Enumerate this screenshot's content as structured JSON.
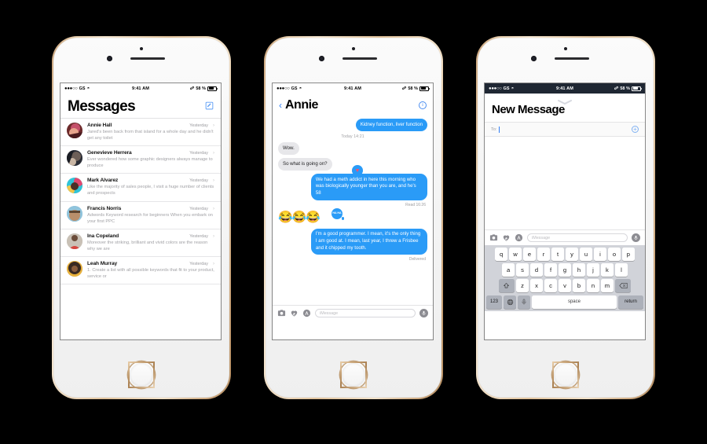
{
  "status_bar": {
    "carrier": "GS",
    "signal_dots": "●●●○○",
    "wifi_icon": "wifi-icon",
    "time": "9:41 AM",
    "bluetooth_icon": "bluetooth-icon",
    "battery_percent": "58 %"
  },
  "phone1": {
    "title": "Messages",
    "compose_icon": "compose-icon",
    "conversations": [
      {
        "name": "Annie Hall",
        "time": "Yesterday",
        "preview": "Jared's been back from that island for a whole day and he didn't get any toilet",
        "avatar_colors": [
          "#6d2a2b",
          "#c4506a",
          "#e7a48c"
        ]
      },
      {
        "name": "Genevieve Herrera",
        "time": "Yesterday",
        "preview": "Ever wondered how some graphic designers always manage to produce",
        "avatar_colors": [
          "#2a2d36",
          "#6d5f58",
          "#c9b6a4"
        ]
      },
      {
        "name": "Mark Alvarez",
        "time": "Yesterday",
        "preview": "Like the majority of sales people, I visit a huge number of clients and prospects",
        "avatar_colors": [
          "#2fc4d8",
          "#e0486f",
          "#f2c64a"
        ]
      },
      {
        "name": "Francis Norris",
        "time": "Yesterday",
        "preview": "Adwords Keyword research for beginners When you embark on your first PPC",
        "avatar_colors": [
          "#8fc4dd",
          "#b98f6b",
          "#5d4632"
        ]
      },
      {
        "name": "Ina Copeland",
        "time": "Yesterday",
        "preview": "Moreover the striking, brilliant and vivid colors are the reason why we are",
        "avatar_colors": [
          "#c9c1b6",
          "#d6453f",
          "#6b4c3a"
        ]
      },
      {
        "name": "Leah Murray",
        "time": "Yesterday",
        "preview": "1. Create a list with all possible keywords that fit to your product, service or",
        "avatar_colors": [
          "#e8b13c",
          "#3a2a22",
          "#8a5c3c"
        ]
      }
    ],
    "chevron": "›"
  },
  "phone2": {
    "back_icon": "back-chevron-icon",
    "title": "Annie",
    "info_icon": "info-icon",
    "messages": [
      {
        "kind": "bubble",
        "side": "out",
        "text": "Kidney function, liver function"
      },
      {
        "kind": "timestamp",
        "text": "Today 14:21"
      },
      {
        "kind": "bubble",
        "side": "in",
        "text": "Wow."
      },
      {
        "kind": "bubble",
        "side": "in",
        "text": "So what is going on?",
        "tapback": "heart"
      },
      {
        "kind": "bubble",
        "side": "out",
        "text": "We had a meth addict in here this morning who was biologically younger than you are, and he's 58"
      },
      {
        "kind": "receipt",
        "text": "Read 16:26"
      },
      {
        "kind": "emoji",
        "text": "😂😂😂",
        "tapback": "haha"
      },
      {
        "kind": "bubble",
        "side": "out",
        "text": "I'm a good programmer. I mean, it's the only thing I am good at. I mean, last year, I threw a Frisbee and it chipped my tooth."
      },
      {
        "kind": "receipt",
        "text": "Delivered"
      }
    ],
    "tapback_haha": "HA HA"
  },
  "phone3": {
    "title": "New Message",
    "to_label": "To:",
    "add_contact_icon": "add-contact-plus-icon"
  },
  "toolbar": {
    "camera_icon": "camera-icon",
    "digital_touch_icon": "digital-touch-heart-icon",
    "app_store_icon": "imessage-apps-icon",
    "placeholder": "iMessage",
    "mic_icon": "microphone-icon"
  },
  "keyboard": {
    "row1": [
      "q",
      "w",
      "e",
      "r",
      "t",
      "y",
      "u",
      "i",
      "o",
      "p"
    ],
    "row2": [
      "a",
      "s",
      "d",
      "f",
      "g",
      "h",
      "j",
      "k",
      "l"
    ],
    "row3": [
      "z",
      "x",
      "c",
      "v",
      "b",
      "n",
      "m"
    ],
    "shift_icon": "shift-arrow-icon",
    "backspace_icon": "backspace-icon",
    "numbers_key": "123",
    "globe_icon": "globe-icon",
    "dictation_icon": "microphone-icon",
    "space_key": "space",
    "return_key": "return"
  },
  "colors": {
    "imessage_blue": "#2a9bf7",
    "grey_bubble": "#e7e7ea",
    "tint_blue": "#2f7df6",
    "keyboard_bg": "#d1d3d9"
  }
}
